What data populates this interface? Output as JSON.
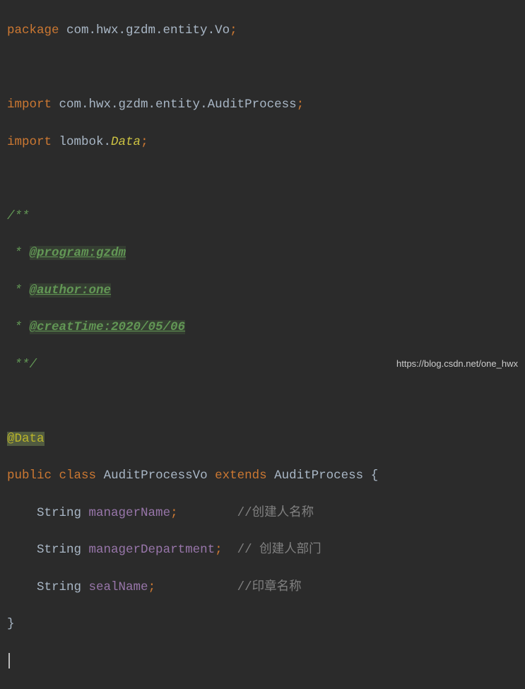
{
  "line1": {
    "kw": "package",
    "sp": " ",
    "pkg": "com.hwx.gzdm.entity.Vo",
    "semi": ";"
  },
  "line2": {
    "blank": ""
  },
  "line3": {
    "kw": "import",
    "sp": " ",
    "pkg": "com.hwx.gzdm.entity.AuditProcess",
    "semi": ";"
  },
  "line4": {
    "kw": "import",
    "sp": " ",
    "pkg": "lombok.",
    "data": "Data",
    "semi": ";"
  },
  "line5": {
    "blank": ""
  },
  "line6": {
    "c": "/**"
  },
  "line7": {
    "star": " * ",
    "tag": "@program:gzdm"
  },
  "line8": {
    "star": " * ",
    "tag": "@author:one"
  },
  "line9": {
    "star": " * ",
    "tag": "@creatTime:2020/05/06"
  },
  "line10": {
    "c": " **/"
  },
  "line11": {
    "blank": ""
  },
  "line12": {
    "anno": "@Data"
  },
  "line13": {
    "kw1": "public",
    "sp1": " ",
    "kw2": "class",
    "sp2": " ",
    "name": "AuditProcessVo",
    "sp3": " ",
    "kw3": "extends",
    "sp4": " ",
    "sup": "AuditProcess",
    "sp5": " ",
    "brace": "{"
  },
  "line14": {
    "indent": "    ",
    "type": "String",
    "sp": " ",
    "field": "managerName",
    "semi": ";",
    "pad": "        ",
    "cmt": "//创建人名称"
  },
  "line15": {
    "indent": "    ",
    "type": "String",
    "sp": " ",
    "field": "managerDepartment",
    "semi": ";",
    "pad": "  ",
    "cmt": "// 创建人部门"
  },
  "line16": {
    "indent": "    ",
    "type": "String",
    "sp": " ",
    "field": "sealName",
    "semi": ";",
    "pad": "           ",
    "cmt": "//印章名称"
  },
  "line17": {
    "brace": "}"
  },
  "watermark": "https://blog.csdn.net/one_hwx"
}
